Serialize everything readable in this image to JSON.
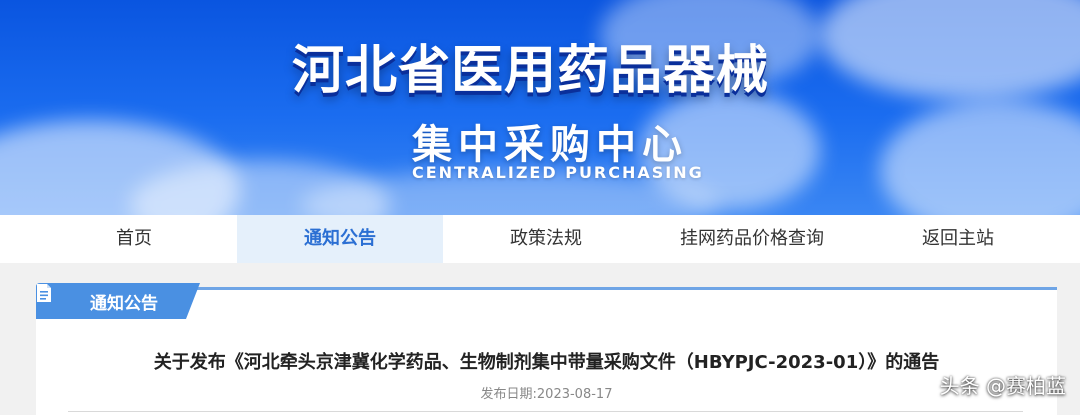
{
  "banner": {
    "title": "河北省医用药品器械",
    "subtitle": "集中采购中心",
    "subtitle_en": "CENTRALIZED PURCHASING"
  },
  "nav": {
    "items": [
      {
        "label": "首页"
      },
      {
        "label": "通知公告"
      },
      {
        "label": "政策法规"
      },
      {
        "label": "挂网药品价格查询"
      },
      {
        "label": "返回主站"
      }
    ],
    "active_index": 1
  },
  "section": {
    "tab_label": "通知公告",
    "tab_icon": "document-icon"
  },
  "article": {
    "title": "关于发布《河北牵头京津冀化学药品、生物制剂集中带量采购文件（HBYPJC-2023-01）》的通告",
    "date_label": "发布日期:2023-08-17"
  },
  "watermark": "头条 @赛柏蓝",
  "colors": {
    "banner_blue": "#1b6df0",
    "nav_active_bg": "#e5f0fb",
    "nav_active_text": "#2b6fd3",
    "tab_blue": "#4a90e2"
  }
}
